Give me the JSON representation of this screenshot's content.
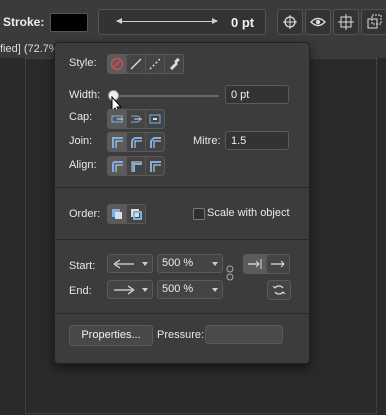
{
  "toolbar": {
    "stroke_label": "Stroke:",
    "stroke_color": "#000000",
    "stroke_width_value": "0 pt",
    "icons": [
      "snap-target-icon",
      "view-eye-icon",
      "align-icon",
      "transform-icon"
    ]
  },
  "document": {
    "tab_title": "fied] (72.7%"
  },
  "panel": {
    "style_label": "Style:",
    "style_options": [
      "none-icon",
      "solid-line-icon",
      "dashed-line-icon",
      "brush-icon"
    ],
    "width_label": "Width:",
    "width_value": "0 pt",
    "width_slider_fraction": 0,
    "cap_label": "Cap:",
    "join_label": "Join:",
    "mitre_label": "Mitre:",
    "mitre_value": "1.5",
    "align_label": "Align:",
    "order_label": "Order:",
    "scale_with_object_label": "Scale with object",
    "scale_with_object_checked": false,
    "start_label": "Start:",
    "end_label": "End:",
    "start_scale": "500 %",
    "end_scale": "500 %",
    "properties_button": "Properties...",
    "pressure_label": "Pressure:"
  }
}
